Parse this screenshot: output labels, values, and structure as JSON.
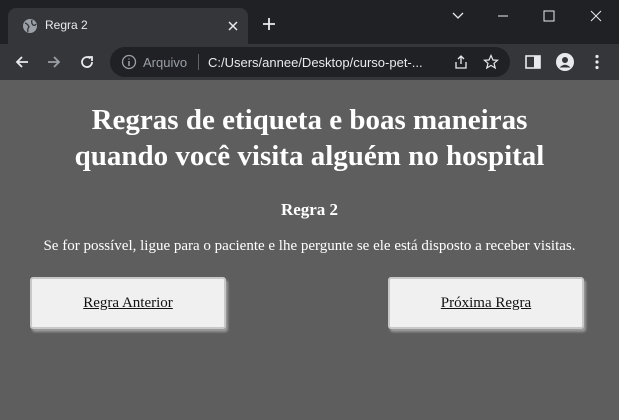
{
  "browser": {
    "tab_title": "Regra 2",
    "omnibox_label": "Arquivo",
    "url": "C:/Users/annee/Desktop/curso-pet-..."
  },
  "page": {
    "title_line1": "Regras de etiqueta e boas maneiras",
    "title_line2": "quando você visita alguém no hospital",
    "rule_heading": "Regra 2",
    "rule_text": "Se for possível, ligue para o paciente e lhe pergunte se ele está disposto a receber visitas.",
    "prev_label": "Regra Anterior",
    "next_label": "Próxima Regra"
  },
  "colors": {
    "page_background": "#5e5e5e",
    "button_background": "#f0f0f0",
    "chrome_dark": "#202124",
    "chrome_toolbar": "#35363a"
  },
  "icons": [
    "globe-icon",
    "close-icon",
    "plus-icon",
    "chevron-down-icon",
    "minimize-icon",
    "maximize-icon",
    "window-close-icon",
    "back-arrow-icon",
    "forward-arrow-icon",
    "reload-icon",
    "info-icon",
    "share-icon",
    "star-icon",
    "side-panel-icon",
    "profile-icon",
    "kebab-menu-icon"
  ]
}
